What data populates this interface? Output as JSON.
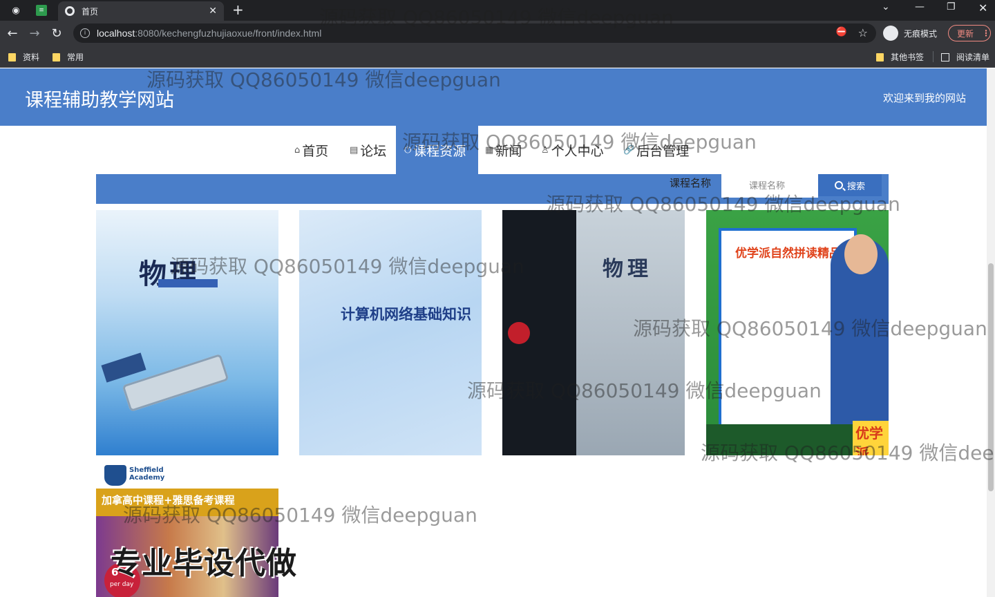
{
  "browser": {
    "tab_title": "首页",
    "url_host": "localhost",
    "url_rest": ":8080/kechengfuzhujiaoxue/front/index.html",
    "incognito_label": "无痕模式",
    "update_label": "更新",
    "bookmarks": [
      "资料",
      "常用"
    ],
    "other_bookmarks": "其他书签",
    "reading_list": "阅读清单"
  },
  "site": {
    "title": "课程辅助教学网站",
    "welcome": "欢迎来到我的网站"
  },
  "nav": {
    "items": [
      {
        "icon": "home-icon",
        "label": "首页"
      },
      {
        "icon": "forum-icon",
        "label": "论坛"
      },
      {
        "icon": "power-icon",
        "label": "课程资源"
      },
      {
        "icon": "grid-icon",
        "label": "新闻"
      },
      {
        "icon": "user-icon",
        "label": "个人中心"
      },
      {
        "icon": "link-icon",
        "label": "后台管理"
      }
    ],
    "active_index": 2
  },
  "search": {
    "label": "课程名称",
    "placeholder": "课程名称",
    "button_label": "搜索"
  },
  "cards": [
    {
      "title": "物理"
    },
    {
      "title": "计算机网络基础知识"
    },
    {
      "title": "物理"
    },
    {
      "title": "优学派自然拼读精品课",
      "badge": "优学派"
    },
    {
      "title": "Sheffield Academy",
      "band": "加拿高中课程+雅思备考课程",
      "circle_number": "6",
      "circle_text": "per day"
    }
  ],
  "promo_text": "专业毕设代做",
  "watermark_text": "源码获取 QQ86050149 微信deepguan",
  "colors": {
    "header_blue": "#4a7ec9",
    "chrome_dark": "#35363a"
  }
}
